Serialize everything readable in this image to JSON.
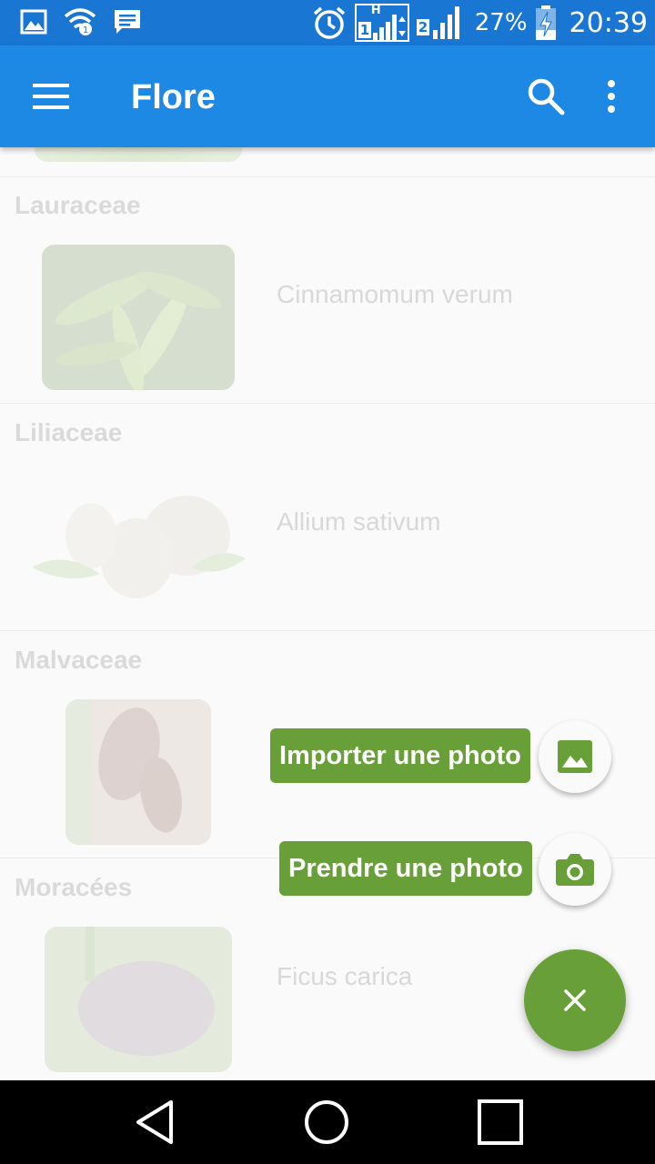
{
  "status_bar": {
    "battery_percent": "27%",
    "time": "20:39",
    "sim1_label": "1",
    "sim2_label": "2",
    "network_label": "H",
    "icons": [
      "gallery-notification-icon",
      "wifi-icon",
      "message-icon",
      "alarm-icon",
      "signal-icon",
      "battery-charging-icon"
    ]
  },
  "app_bar": {
    "title": "Flore",
    "icons": [
      "menu-icon",
      "search-icon",
      "more-vert-icon"
    ]
  },
  "list": {
    "sections": [
      {
        "family": "Lauraceae",
        "species": "Cinnamomum verum"
      },
      {
        "family": "Liliaceae",
        "species": "Allium sativum"
      },
      {
        "family": "Malvaceae",
        "species": ""
      },
      {
        "family": "Moracées",
        "species": "Ficus carica"
      }
    ]
  },
  "speed_dial": {
    "import_label": "Importer une photo",
    "take_label": "Prendre une photo",
    "accent_color": "#689f38",
    "icons": [
      "image-icon",
      "camera-icon",
      "close-icon"
    ]
  },
  "colors": {
    "status_bar": "#1976d2",
    "app_bar": "#1e88e5",
    "fab": "#689f38"
  }
}
